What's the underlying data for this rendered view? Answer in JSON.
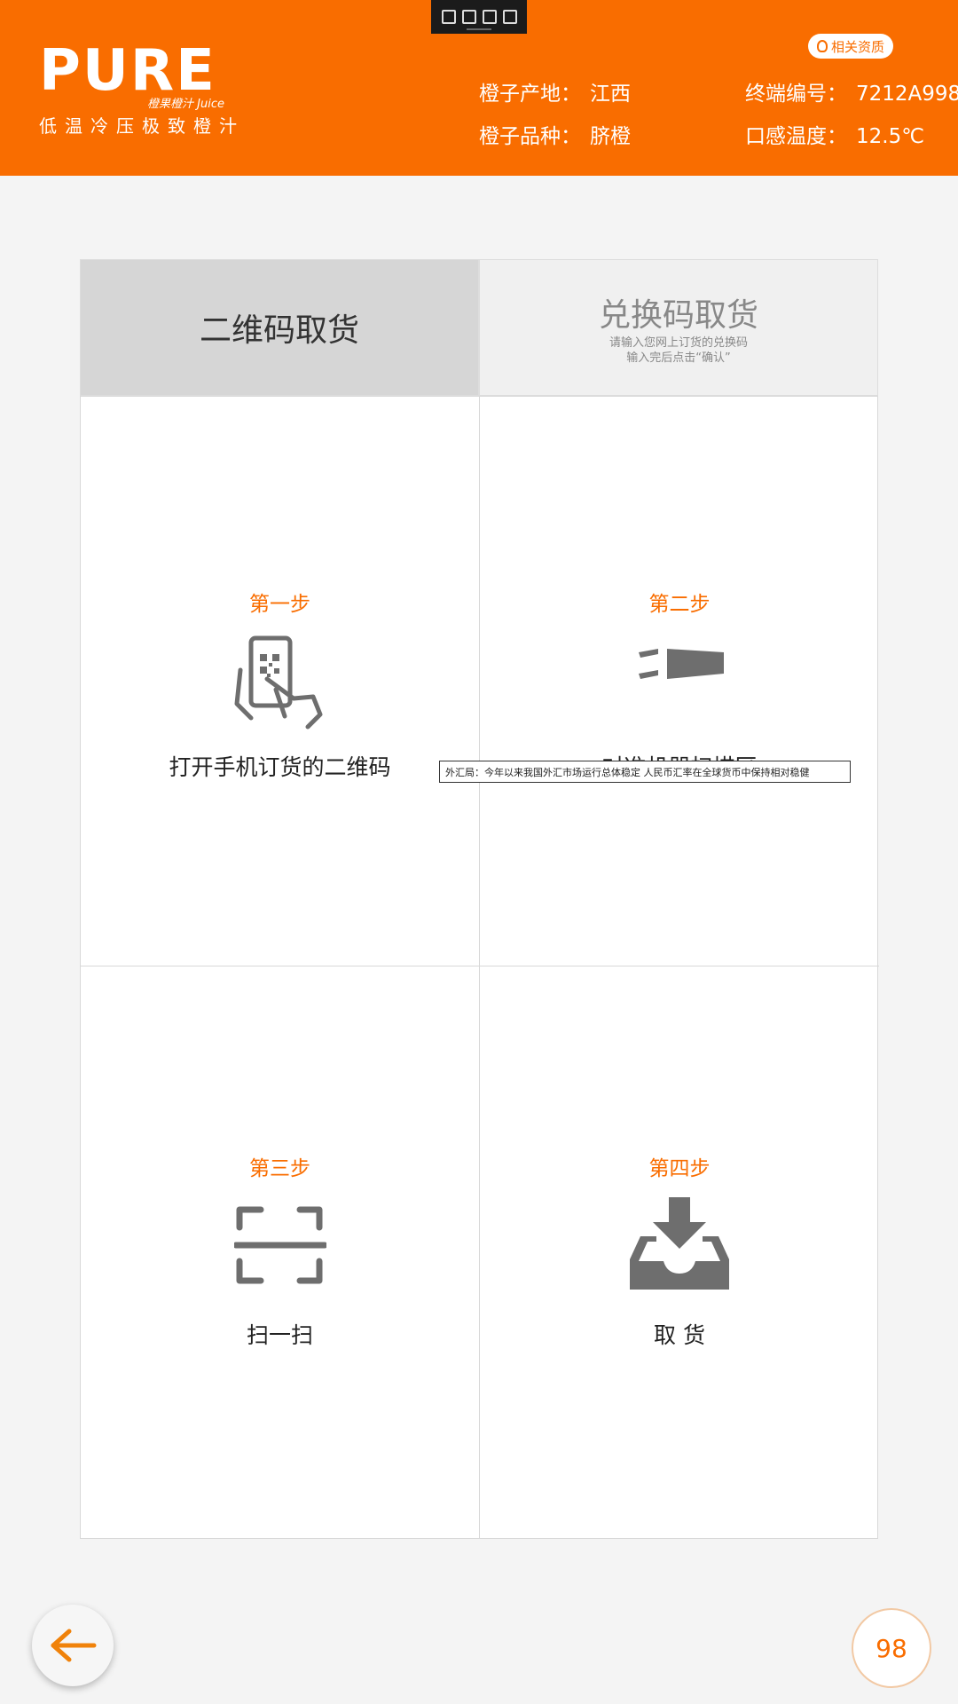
{
  "brand": {
    "logo_text": "PURE",
    "logo_sub": "橙果橙汁 Juice",
    "tagline": "低温冷压极致橙汁"
  },
  "header": {
    "qualification_label": "相关资质",
    "origin_label": "橙子产地：",
    "origin_value": "江西",
    "variety_label": "橙子品种：",
    "variety_value": "脐橙",
    "terminal_label": "终端编号：",
    "terminal_value": "7212A998",
    "temp_label": "口感温度：",
    "temp_value": "12.5℃"
  },
  "tabs": {
    "qr": {
      "title": "二维码取货"
    },
    "code": {
      "title": "兑换码取货",
      "hint_line1": "请输入您网上订货的兑换码",
      "hint_line2": "输入完后点击“确认”"
    }
  },
  "steps": [
    {
      "title": "第一步",
      "desc": "打开手机订货的二维码",
      "icon": "phone-qr-icon"
    },
    {
      "title": "第二步",
      "desc": "对准机器扫描区",
      "icon": "scanner-icon"
    },
    {
      "title": "第三步",
      "desc": "扫一扫",
      "icon": "scan-frame-icon"
    },
    {
      "title": "第四步",
      "desc": "取 货",
      "icon": "inbox-download-icon"
    }
  ],
  "tooltip_text": "外汇局：今年以来我国外汇市场运行总体稳定 人民币汇率在全球货币中保持相对稳健",
  "counter": "98",
  "colors": {
    "primary": "#f96d00",
    "icon_gray": "#6e6e6e"
  }
}
